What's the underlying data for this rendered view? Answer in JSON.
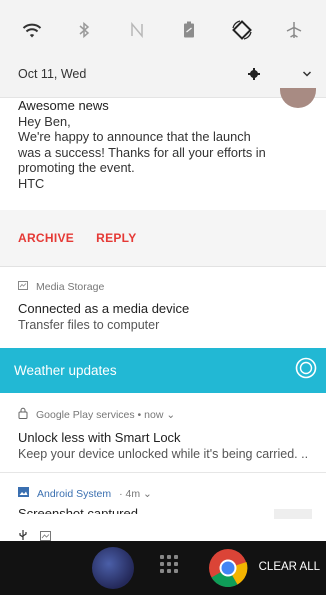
{
  "quick_settings": {
    "date": "Oct 11, Wed",
    "tiles": [
      "wifi-icon",
      "bluetooth-icon",
      "nfc-icon",
      "battery-saver-icon",
      "auto-rotate-icon",
      "airplane-mode-icon"
    ],
    "settings_icon": "gear-icon",
    "expand_icon": "chevron-down-icon"
  },
  "email_notification": {
    "title": "Awesome news",
    "lines": [
      "Hey Ben,",
      "We're happy to announce that the launch",
      "was a success! Thanks for all your efforts in",
      "promoting the event.",
      "HTC"
    ],
    "actions": [
      "ARCHIVE",
      "REPLY"
    ]
  },
  "media_storage": {
    "app": "Media Storage",
    "title": "Connected as a media device",
    "subtitle": "Transfer files to computer"
  },
  "weather": {
    "title": "Weather updates"
  },
  "google_play_services": {
    "app_line": "Google Play services • now ⌄",
    "title": "Unlock less with Smart Lock",
    "subtitle": "Keep your device unlocked while it's being carried. .."
  },
  "android_system": {
    "app": "Android System",
    "time": "· 4m ⌄",
    "title_partial": "Screenshot captured"
  },
  "dock": {
    "clear_all": "CLEAR ALL"
  },
  "colors": {
    "accent_red": "#e53935",
    "weather_bar": "#22b8d4"
  }
}
